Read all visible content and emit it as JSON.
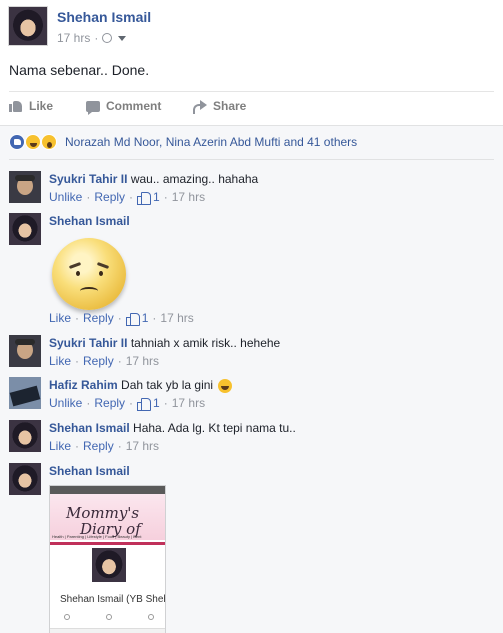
{
  "post": {
    "author": "Shehan Ismail",
    "time": "17 hrs",
    "text": "Nama sebenar.. Done.",
    "actions": {
      "like": "Like",
      "comment": "Comment",
      "share": "Share"
    },
    "reactions_text": "Norazah Md Noor, Nina Azerin Abd Mufti and 41 others"
  },
  "comments": [
    {
      "name": "Syukri Tahir II",
      "text": "wau.. amazing.. hahaha",
      "unlike": "Unlike",
      "reply": "Reply",
      "likes": "1",
      "time": "17 hrs"
    },
    {
      "name": "Shehan Ismail",
      "like": "Like",
      "reply": "Reply",
      "likes": "1",
      "time": "17 hrs"
    },
    {
      "name": "Syukri Tahir II",
      "text": "tahniah x amik risk.. hehehe",
      "like": "Like",
      "reply": "Reply",
      "time": "17 hrs"
    },
    {
      "name": "Hafiz Rahim",
      "text": "Dah tak yb la gini",
      "unlike": "Unlike",
      "reply": "Reply",
      "likes": "1",
      "time": "17 hrs"
    },
    {
      "name": "Shehan Ismail",
      "text": "Haha. Ada lg. Kt tepi nama tu..",
      "like": "Like",
      "reply": "Reply",
      "time": "17 hrs"
    },
    {
      "name": "Shehan Ismail"
    }
  ],
  "photo": {
    "title_line1": "Mommy's",
    "title_line2": "Diary of",
    "strip": "Health | Parenting | Lifestyle | Food | Beauty | Bent",
    "name": "Shehan Ismail (YB Shehan)"
  }
}
